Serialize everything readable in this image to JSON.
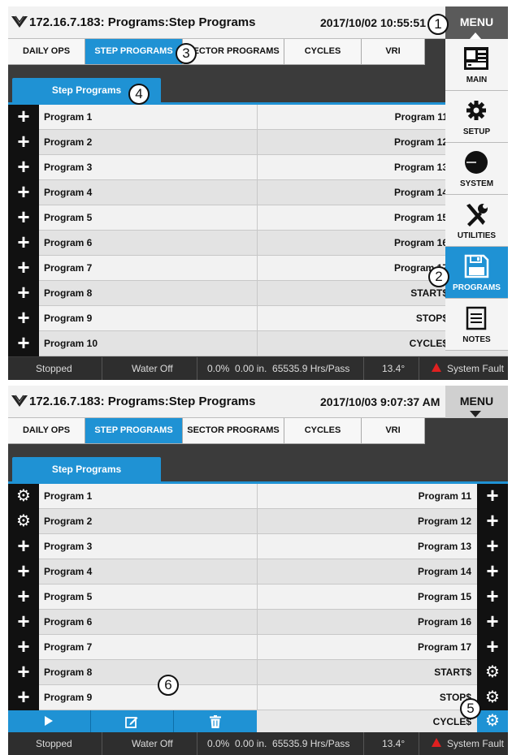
{
  "colors": {
    "accent": "#1f92d4",
    "fault": "#e02020",
    "dark": "#111111"
  },
  "screen1": {
    "title": "172.16.7.183: Programs:Step Programs",
    "datetime": "2017/10/02 10:55:51 AM",
    "menu_label": "MENU",
    "tabs": [
      "DAILY OPS",
      "STEP PROGRAMS",
      "SECTOR PROGRAMS",
      "CYCLES",
      "VRI"
    ],
    "active_tab": "STEP PROGRAMS",
    "panel_tab": "Step Programs",
    "rows": [
      {
        "left": "Program 1",
        "right": "Program 11"
      },
      {
        "left": "Program 2",
        "right": "Program 12"
      },
      {
        "left": "Program 3",
        "right": "Program 13"
      },
      {
        "left": "Program 4",
        "right": "Program 14"
      },
      {
        "left": "Program 5",
        "right": "Program 15"
      },
      {
        "left": "Program 6",
        "right": "Program 16"
      },
      {
        "left": "Program 7",
        "right": "Program 17"
      },
      {
        "left": "Program 8",
        "right": "START$"
      },
      {
        "left": "Program 9",
        "right": "STOP$"
      },
      {
        "left": "Program 10",
        "right": "CYCLE$"
      }
    ],
    "side_menu": [
      {
        "label": "MAIN",
        "icon": "main-panel-icon"
      },
      {
        "label": "SETUP",
        "icon": "gear-icon"
      },
      {
        "label": "SYSTEM",
        "icon": "system-dial-icon"
      },
      {
        "label": "UTILITIES",
        "icon": "tools-icon"
      },
      {
        "label": "PROGRAMS",
        "icon": "floppy-disk-icon"
      },
      {
        "label": "NOTES",
        "icon": "notes-icon"
      }
    ],
    "active_menu": "PROGRAMS",
    "status": {
      "state": "Stopped",
      "water": "Water Off",
      "metrics": "0.0%  0.00 in.  65535.9 Hrs/Pass",
      "angle": "13.4°",
      "fault": "System Fault"
    }
  },
  "screen2": {
    "title": "172.16.7.183: Programs:Step Programs",
    "datetime": "2017/10/03 9:07:37 AM",
    "menu_label": "MENU",
    "tabs": [
      "DAILY OPS",
      "STEP PROGRAMS",
      "SECTOR PROGRAMS",
      "CYCLES",
      "VRI"
    ],
    "active_tab": "STEP PROGRAMS",
    "panel_tab": "Step Programs",
    "rows": [
      {
        "left": "Program 1",
        "right": "Program 11",
        "left_icon": "gear-icon",
        "right_icon": "plus-icon"
      },
      {
        "left": "Program 2",
        "right": "Program 12",
        "left_icon": "gear-icon",
        "right_icon": "plus-icon"
      },
      {
        "left": "Program 3",
        "right": "Program 13",
        "left_icon": "plus-icon",
        "right_icon": "plus-icon"
      },
      {
        "left": "Program 4",
        "right": "Program 14",
        "left_icon": "plus-icon",
        "right_icon": "plus-icon"
      },
      {
        "left": "Program 5",
        "right": "Program 15",
        "left_icon": "plus-icon",
        "right_icon": "plus-icon"
      },
      {
        "left": "Program 6",
        "right": "Program 16",
        "left_icon": "plus-icon",
        "right_icon": "plus-icon"
      },
      {
        "left": "Program 7",
        "right": "Program 17",
        "left_icon": "plus-icon",
        "right_icon": "plus-icon"
      },
      {
        "left": "Program 8",
        "right": "START$",
        "left_icon": "plus-icon",
        "right_icon": "gear-icon"
      },
      {
        "left": "Program 9",
        "right": "STOP$",
        "left_icon": "plus-icon",
        "right_icon": "gear-icon"
      }
    ],
    "last_row_right": "CYCLE$",
    "action_bar": [
      "play-icon",
      "edit-icon",
      "trash-icon"
    ],
    "status": {
      "state": "Stopped",
      "water": "Water Off",
      "metrics": "0.0%  0.00 in.  65535.9 Hrs/Pass",
      "angle": "13.4°",
      "fault": "System Fault"
    }
  },
  "callouts": [
    "1",
    "2",
    "3",
    "4",
    "5",
    "6"
  ]
}
